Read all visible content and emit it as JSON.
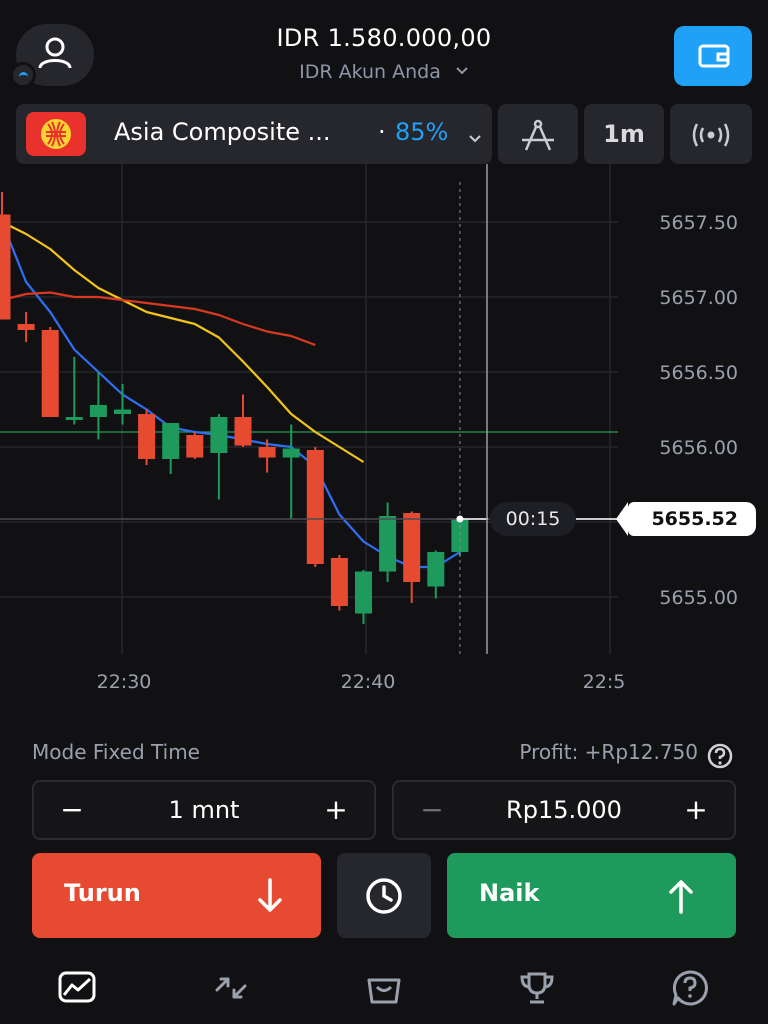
{
  "header": {
    "balance": "IDR 1.580.000,00",
    "account_label": "IDR Akun Anda",
    "icons": {
      "profile": "user-icon",
      "wallet": "wallet-icon"
    }
  },
  "asset": {
    "name": "Asia Composite ...",
    "separator": "·",
    "payout": "85%",
    "flag_icon": "asean-flag-icon"
  },
  "toolbar": {
    "timeframe": "1m",
    "icons": {
      "draw": "drawing-tools-icon",
      "signal": "signal-broadcast-icon"
    }
  },
  "chart_data": {
    "type": "candlestick",
    "y_ticks": [
      "5657.50",
      "5657.00",
      "5656.50",
      "5656.00",
      "5655.00"
    ],
    "x_ticks": [
      "22:30",
      "22:40",
      "22:5"
    ],
    "ylim": [
      5654.5,
      5657.8
    ],
    "current_price": "5655.52",
    "countdown": "00:15",
    "reference_line": 5656.1,
    "candles": [
      {
        "o": 5657.55,
        "h": 5657.7,
        "l": 5656.9,
        "c": 5656.85,
        "dir": "down"
      },
      {
        "o": 5656.82,
        "h": 5656.9,
        "l": 5656.7,
        "c": 5656.78,
        "dir": "down"
      },
      {
        "o": 5656.78,
        "h": 5656.8,
        "l": 5656.2,
        "c": 5656.2,
        "dir": "down"
      },
      {
        "o": 5656.2,
        "h": 5656.6,
        "l": 5656.15,
        "c": 5656.2,
        "dir": "up"
      },
      {
        "o": 5656.2,
        "h": 5656.5,
        "l": 5656.05,
        "c": 5656.28,
        "dir": "up"
      },
      {
        "o": 5656.22,
        "h": 5656.42,
        "l": 5656.15,
        "c": 5656.25,
        "dir": "up"
      },
      {
        "o": 5656.22,
        "h": 5656.25,
        "l": 5655.88,
        "c": 5655.92,
        "dir": "down"
      },
      {
        "o": 5655.92,
        "h": 5656.15,
        "l": 5655.82,
        "c": 5656.16,
        "dir": "up"
      },
      {
        "o": 5656.08,
        "h": 5656.1,
        "l": 5655.92,
        "c": 5655.93,
        "dir": "down"
      },
      {
        "o": 5655.96,
        "h": 5656.22,
        "l": 5655.65,
        "c": 5656.2,
        "dir": "up"
      },
      {
        "o": 5656.2,
        "h": 5656.35,
        "l": 5656.0,
        "c": 5656.01,
        "dir": "down"
      },
      {
        "o": 5656.0,
        "h": 5656.05,
        "l": 5655.83,
        "c": 5655.93,
        "dir": "down"
      },
      {
        "o": 5655.93,
        "h": 5656.15,
        "l": 5655.52,
        "c": 5655.99,
        "dir": "up"
      },
      {
        "o": 5655.98,
        "h": 5656.0,
        "l": 5655.2,
        "c": 5655.22,
        "dir": "down"
      },
      {
        "o": 5655.26,
        "h": 5655.28,
        "l": 5654.91,
        "c": 5654.94,
        "dir": "down"
      },
      {
        "o": 5654.89,
        "h": 5655.18,
        "l": 5654.82,
        "c": 5655.17,
        "dir": "up"
      },
      {
        "o": 5655.17,
        "h": 5655.63,
        "l": 5655.1,
        "c": 5655.54,
        "dir": "up"
      },
      {
        "o": 5655.56,
        "h": 5655.57,
        "l": 5654.96,
        "c": 5655.1,
        "dir": "down"
      },
      {
        "o": 5655.07,
        "h": 5655.31,
        "l": 5654.99,
        "c": 5655.3,
        "dir": "up"
      },
      {
        "o": 5655.3,
        "h": 5655.52,
        "l": 5655.27,
        "c": 5655.52,
        "dir": "up"
      }
    ],
    "ma_series": [
      {
        "color": "#2f6ff2",
        "values": [
          5657.5,
          5657.1,
          5656.9,
          5656.65,
          5656.5,
          5656.35,
          5656.25,
          5656.13,
          5656.1,
          5656.08,
          5656.05,
          5656.02,
          5656.0,
          5655.87,
          5655.55,
          5655.37,
          5655.27,
          5655.2,
          5655.2,
          5655.3
        ]
      },
      {
        "color": "#f2c518",
        "values": [
          5657.5,
          5657.42,
          5657.32,
          5657.18,
          5657.06,
          5656.98,
          5656.9,
          5656.86,
          5656.82,
          5656.73,
          5656.57,
          5656.4,
          5656.22,
          5656.1,
          5656.0,
          5655.9
        ]
      },
      {
        "color": "#d9391f",
        "values": [
          5656.98,
          5657.02,
          5657.03,
          5657.0,
          5657.0,
          5656.98,
          5656.96,
          5656.94,
          5656.92,
          5656.88,
          5656.82,
          5656.77,
          5656.74,
          5656.68
        ]
      }
    ]
  },
  "trade": {
    "mode_label": "Mode Fixed Time",
    "profit_label": "Profit: +Rp12.750",
    "duration": {
      "value": "1 mnt",
      "minus": "−",
      "plus": "+"
    },
    "amount": {
      "value": "Rp15.000",
      "minus": "−",
      "plus": "+"
    },
    "down_label": "Turun",
    "up_label": "Naik",
    "colors": {
      "down": "#e64b32",
      "up": "#1f9a5d",
      "accent": "#1ea1f7"
    }
  },
  "nav": {
    "items": [
      "chart-icon",
      "trades-icon",
      "market-icon",
      "tournament-icon",
      "support-icon"
    ]
  }
}
